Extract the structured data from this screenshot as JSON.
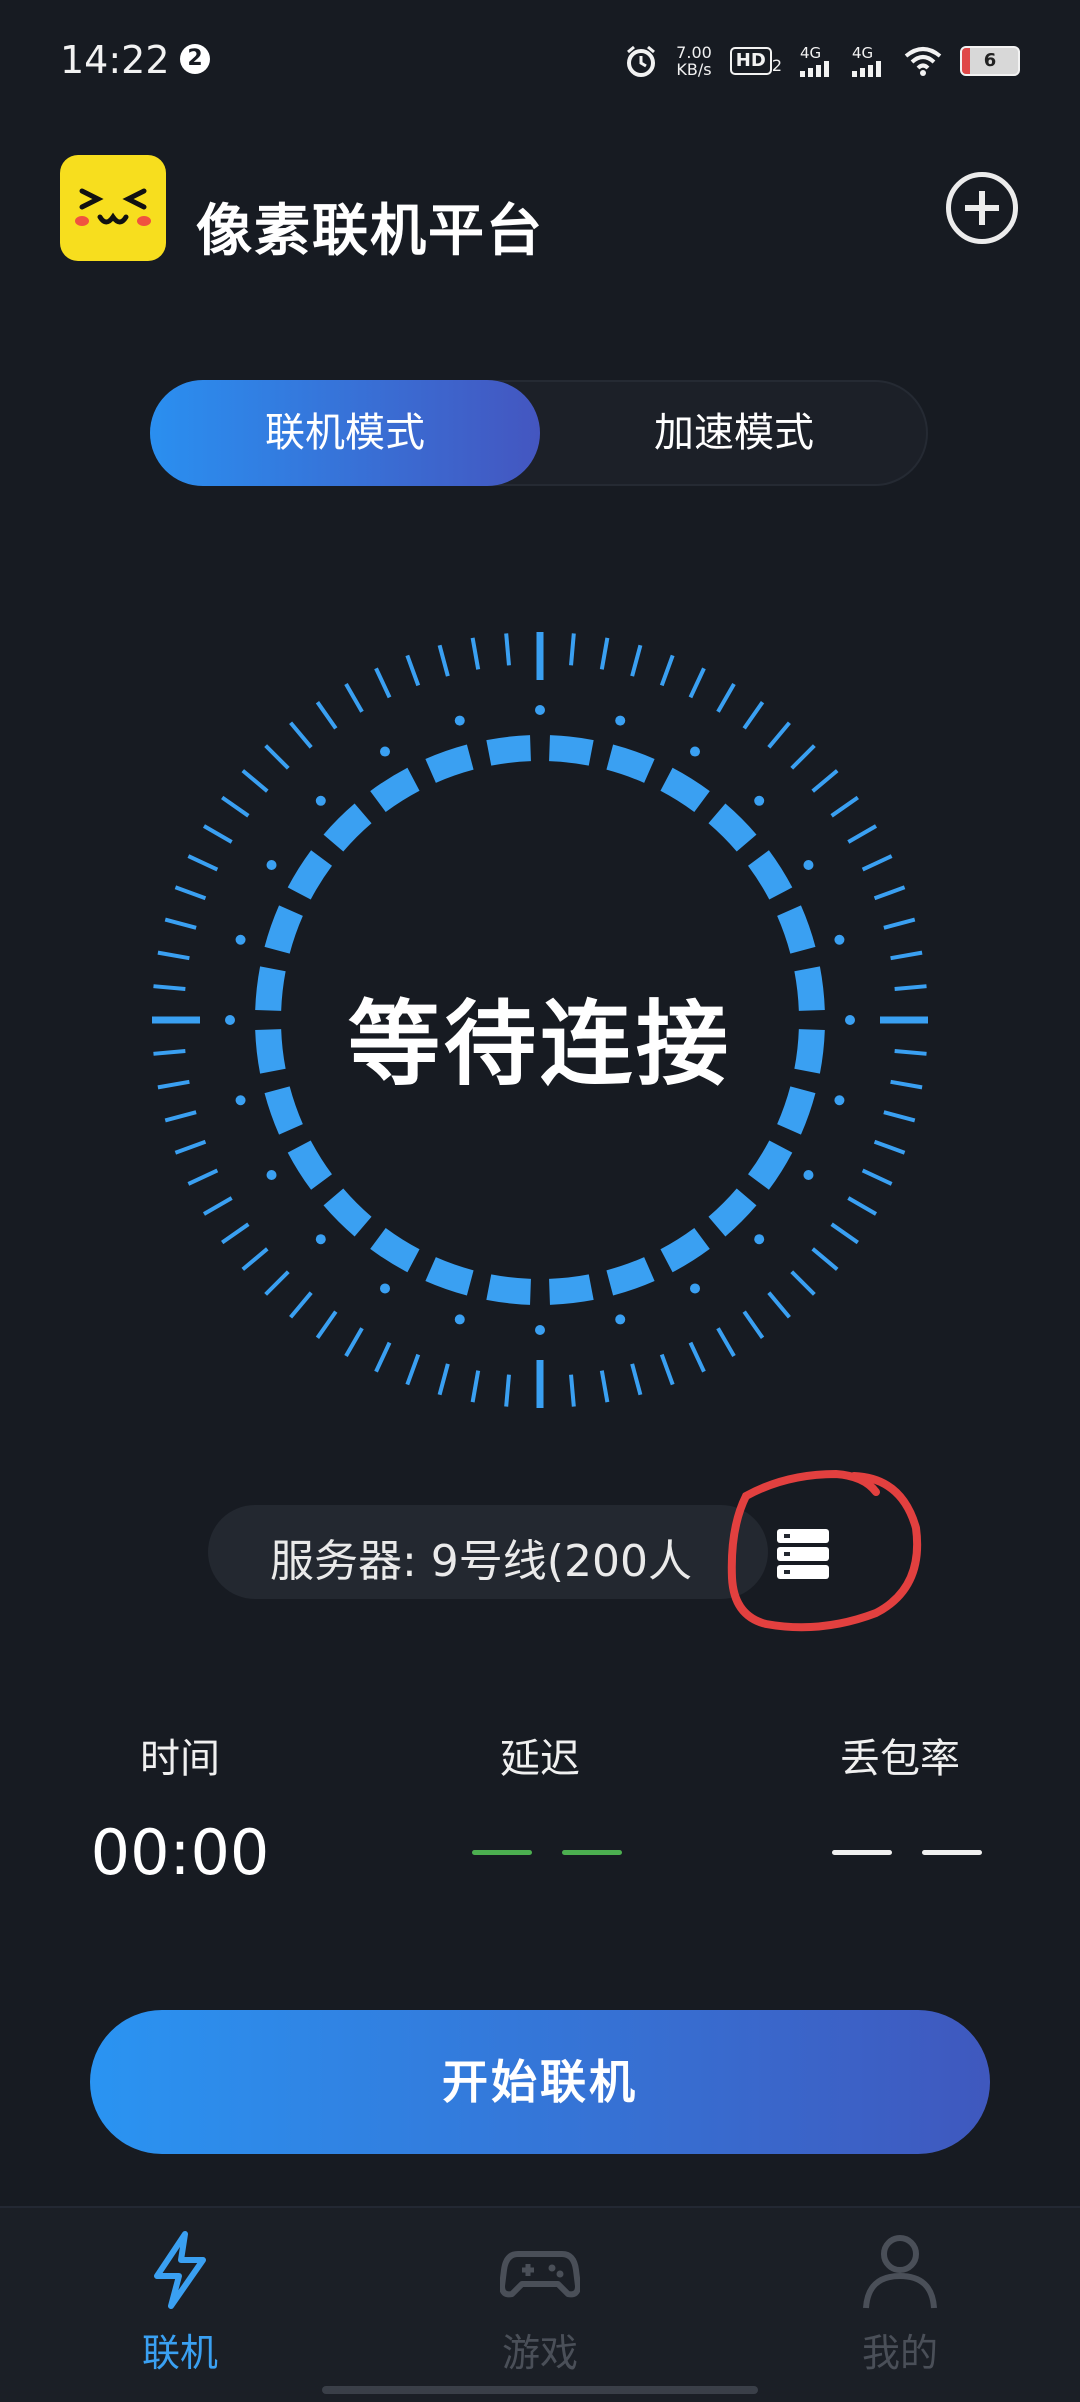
{
  "status_bar": {
    "time": "14:22",
    "notification_count": "2",
    "net_speed_value": "7.00",
    "net_speed_unit": "KB/s",
    "hd": "HD",
    "hd_sub": "2",
    "signal1": "4G",
    "signal2": "4G",
    "battery": "6"
  },
  "header": {
    "title": "像素联机平台",
    "logo_icon": "kaomoji-face-logo",
    "add_icon": "plus-circle-icon"
  },
  "mode_tabs": [
    {
      "label": "联机模式",
      "active": true
    },
    {
      "label": "加速模式",
      "active": false
    }
  ],
  "connection": {
    "status": "等待连接"
  },
  "server": {
    "label": "服务器:  9号线(200人",
    "icon": "server-icon"
  },
  "stats": {
    "time_label": "时间",
    "time_value": "00:00",
    "latency_label": "延迟",
    "packet_loss_label": "丢包率"
  },
  "start_button": "开始联机",
  "nav": [
    {
      "label": "联机",
      "icon": "lightning-icon",
      "active": true
    },
    {
      "label": "游戏",
      "icon": "gamepad-icon",
      "active": false
    },
    {
      "label": "我的",
      "icon": "user-icon",
      "active": false
    }
  ],
  "colors": {
    "background": "#171b22",
    "accent": "#3aa0f2",
    "gradient_start": "#2a8ff0",
    "gradient_end": "#4456c0",
    "latency_dash": "#4caf50",
    "highlight_circle": "#e2403f",
    "logo_yellow": "#f7de1e"
  }
}
